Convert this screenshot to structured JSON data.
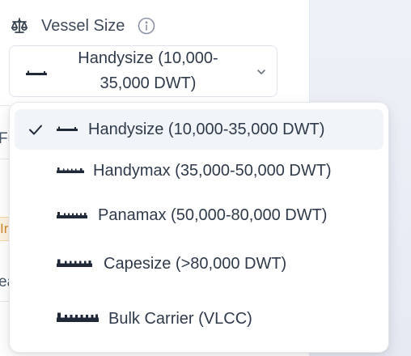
{
  "vessel_size": {
    "label": "Vessel Size",
    "label_icon": "scale-icon",
    "info_icon": "info-icon",
    "selected_value": "Handysize (10,000-35,000 DWT)",
    "dropdown_icon": "chevron-down-icon"
  },
  "options": [
    {
      "label": "Handysize (10,000-35,000 DWT)",
      "icon": "ship-icon",
      "selected": true
    },
    {
      "label": "Handymax (35,000-50,000 DWT)",
      "icon": "ship-icon",
      "selected": false
    },
    {
      "label": "Panamax (50,000-80,000 DWT)",
      "icon": "ship-icon",
      "selected": false
    },
    {
      "label": "Capesize (>80,000 DWT)",
      "icon": "ship-icon",
      "selected": false
    },
    {
      "label": "Bulk Carrier (VLCC)",
      "icon": "ship-icon",
      "selected": false
    }
  ],
  "background_peek": {
    "row1": "Fu",
    "badge": "Ir",
    "row3": "ea"
  },
  "colors": {
    "text": "#2f3a4a",
    "label": "#3f4a5a",
    "border": "#dfe3ea",
    "selected_bg": "#f1f4f9",
    "badge_text": "#d0892a",
    "badge_bg": "#fdf3e3"
  }
}
